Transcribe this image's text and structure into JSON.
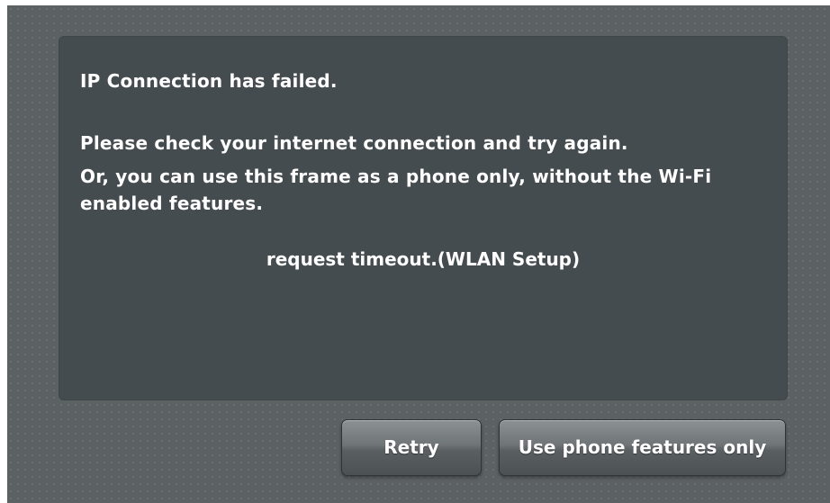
{
  "dialog": {
    "title": "IP Connection has failed.",
    "line1": "Please check your internet connection and try again.",
    "line2": "Or, you can use this frame as a phone only, without the Wi-Fi",
    "line3": "enabled features.",
    "error": "request timeout.(WLAN Setup)"
  },
  "buttons": {
    "retry_label": "Retry",
    "phone_only_label": "Use phone features only"
  },
  "colors": {
    "background": "#5c6163",
    "dialog": "#454c4f",
    "text": "#ffffff"
  }
}
